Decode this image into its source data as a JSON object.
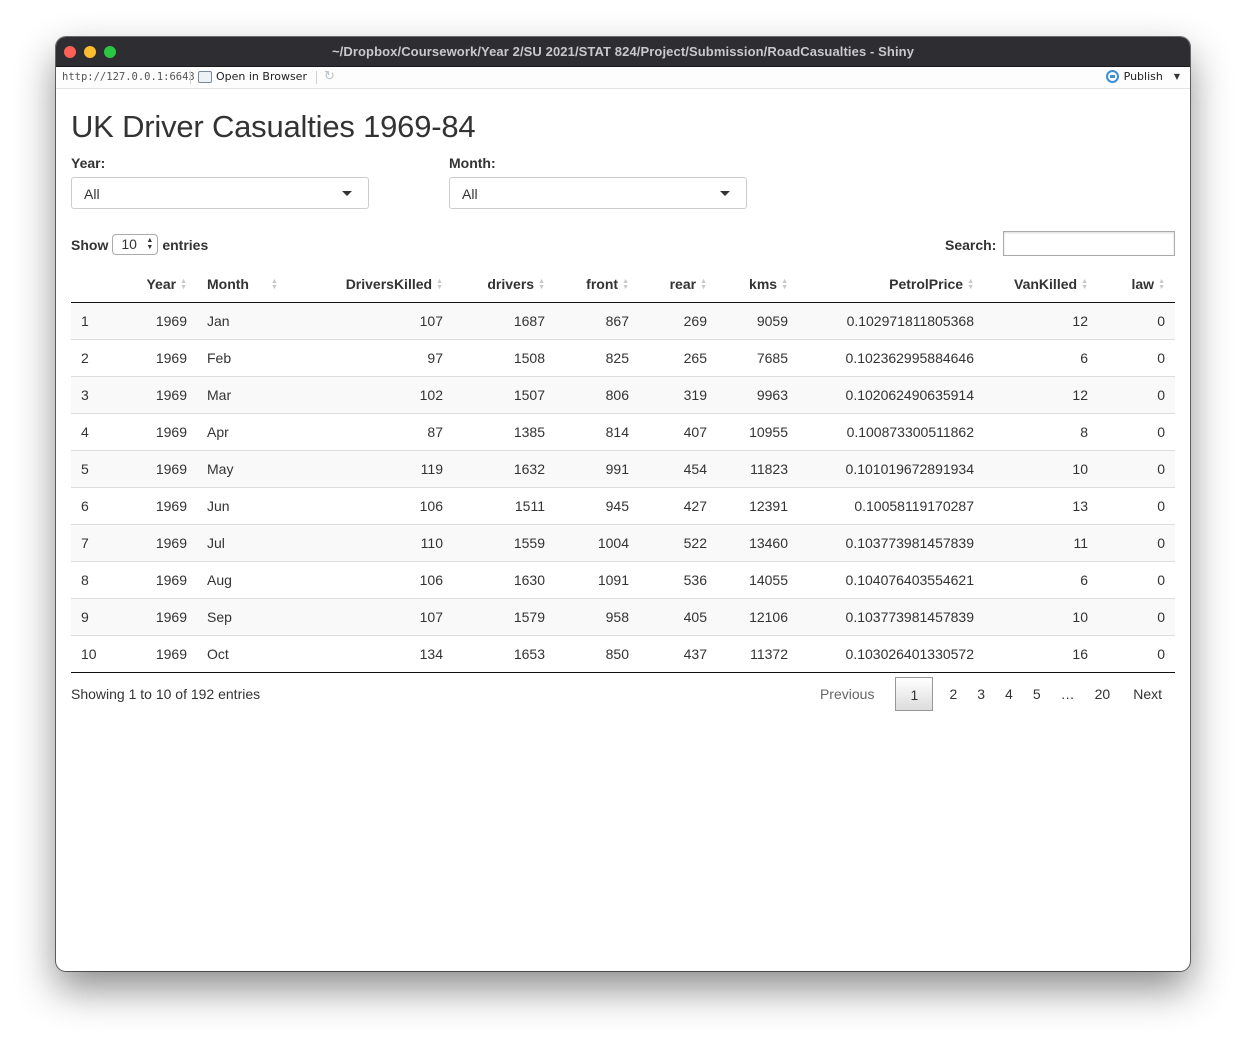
{
  "window": {
    "title": "~/Dropbox/Coursework/Year 2/SU 2021/STAT 824/Project/Submission/RoadCasualties - Shiny"
  },
  "toolbar": {
    "url": "http://127.0.0.1:6643",
    "open_in_browser": "Open in Browser",
    "publish": "Publish"
  },
  "page": {
    "title": "UK Driver Casualties 1969-84"
  },
  "filters": {
    "year_label": "Year:",
    "year_value": "All",
    "month_label": "Month:",
    "month_value": "All"
  },
  "table_controls": {
    "show_label": "Show",
    "length_value": "10",
    "entries_label": "entries",
    "search_label": "Search:",
    "search_value": ""
  },
  "table": {
    "columns": [
      "",
      "Year",
      "Month",
      "DriversKilled",
      "drivers",
      "front",
      "rear",
      "kms",
      "PetrolPrice",
      "VanKilled",
      "law"
    ],
    "rows": [
      [
        "1",
        "1969",
        "Jan",
        "107",
        "1687",
        "867",
        "269",
        "9059",
        "0.102971811805368",
        "12",
        "0"
      ],
      [
        "2",
        "1969",
        "Feb",
        "97",
        "1508",
        "825",
        "265",
        "7685",
        "0.102362995884646",
        "6",
        "0"
      ],
      [
        "3",
        "1969",
        "Mar",
        "102",
        "1507",
        "806",
        "319",
        "9963",
        "0.102062490635914",
        "12",
        "0"
      ],
      [
        "4",
        "1969",
        "Apr",
        "87",
        "1385",
        "814",
        "407",
        "10955",
        "0.100873300511862",
        "8",
        "0"
      ],
      [
        "5",
        "1969",
        "May",
        "119",
        "1632",
        "991",
        "454",
        "11823",
        "0.101019672891934",
        "10",
        "0"
      ],
      [
        "6",
        "1969",
        "Jun",
        "106",
        "1511",
        "945",
        "427",
        "12391",
        "0.10058119170287",
        "13",
        "0"
      ],
      [
        "7",
        "1969",
        "Jul",
        "110",
        "1559",
        "1004",
        "522",
        "13460",
        "0.103773981457839",
        "11",
        "0"
      ],
      [
        "8",
        "1969",
        "Aug",
        "106",
        "1630",
        "1091",
        "536",
        "14055",
        "0.104076403554621",
        "6",
        "0"
      ],
      [
        "9",
        "1969",
        "Sep",
        "107",
        "1579",
        "958",
        "405",
        "12106",
        "0.103773981457839",
        "10",
        "0"
      ],
      [
        "10",
        "1969",
        "Oct",
        "134",
        "1653",
        "850",
        "437",
        "11372",
        "0.103026401330572",
        "16",
        "0"
      ]
    ]
  },
  "footer": {
    "info": "Showing 1 to 10 of 192 entries",
    "previous": "Previous",
    "next": "Next",
    "pages": [
      "1",
      "2",
      "3",
      "4",
      "5",
      "…",
      "20"
    ],
    "current_page": "1"
  }
}
